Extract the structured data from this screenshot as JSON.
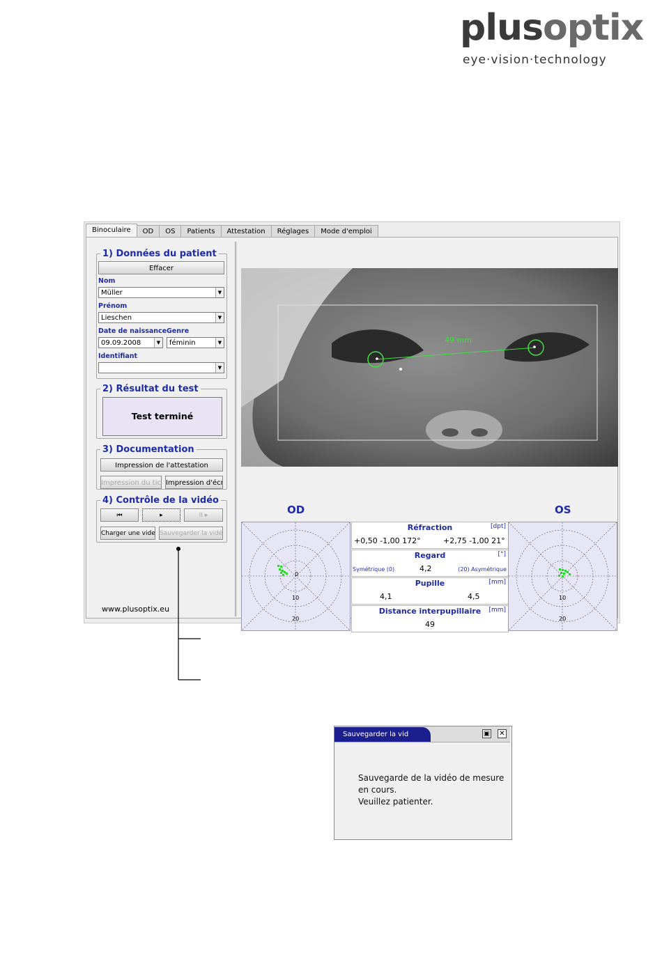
{
  "logo": {
    "brand_plus": "plus",
    "brand_optix": "optix",
    "tagline": "eye·vision·technology"
  },
  "tabs": [
    "Binoculaire",
    "OD",
    "OS",
    "Patients",
    "Attestation",
    "Réglages",
    "Mode d'emploi"
  ],
  "patient": {
    "legend": "1) Données du patient",
    "clear_btn": "Effacer",
    "nom_label": "Nom",
    "nom_value": "Müller",
    "prenom_label": "Prénom",
    "prenom_value": "Lieschen",
    "dob_label": "Date de naissance",
    "dob_value": "09.09.2008",
    "genre_label": "Genre",
    "genre_value": "féminin",
    "id_label": "Identifiant",
    "id_value": ""
  },
  "result": {
    "legend": "2) Résultat du test",
    "status": "Test terminé"
  },
  "documentation": {
    "legend": "3) Documentation",
    "print_attestation": "Impression de l'attestation",
    "print_ticket": "Impression du ticket",
    "print_screen": "Impression d'écran"
  },
  "video": {
    "legend": "4) Contrôle de la vidéo",
    "rewind": "⏮",
    "play": "▸",
    "pause": "II ▸",
    "load": "Charger une video",
    "save": "Sauvegarder la vidéo"
  },
  "website": "www.plusoptix.eu",
  "photo": {
    "distance_label": "49 mm"
  },
  "measure": {
    "od_title": "OD",
    "os_title": "OS",
    "refraction": {
      "title": "Réfraction",
      "unit": "[dpt]",
      "od": "+0,50  -1,00 172°",
      "os": "+2,75  -1,00 21°"
    },
    "gaze": {
      "title": "Regard",
      "unit": "[°]",
      "left_scale": "Symétrique (0)",
      "value": "4,2",
      "right_scale": "(20) Asymétrique"
    },
    "pupil": {
      "title": "Pupille",
      "unit": "[mm]",
      "od": "4,1",
      "os": "4,5"
    },
    "ipd": {
      "title": "Distance interpupillaire",
      "unit": "[mm]",
      "value": "49"
    },
    "polar_labels": [
      "0",
      "10",
      "20"
    ]
  },
  "dialog": {
    "title": "Sauvegarder la vid",
    "restore_icon": "▣",
    "close_icon": "✕",
    "line1": "Sauvegarde de la vidéo de mesure",
    "line2": "en cours.",
    "line3": "Veuillez patienter."
  },
  "colors": {
    "accent": "#1d2ba8",
    "title_bar": "#1c1f8e",
    "green": "#40e040"
  }
}
